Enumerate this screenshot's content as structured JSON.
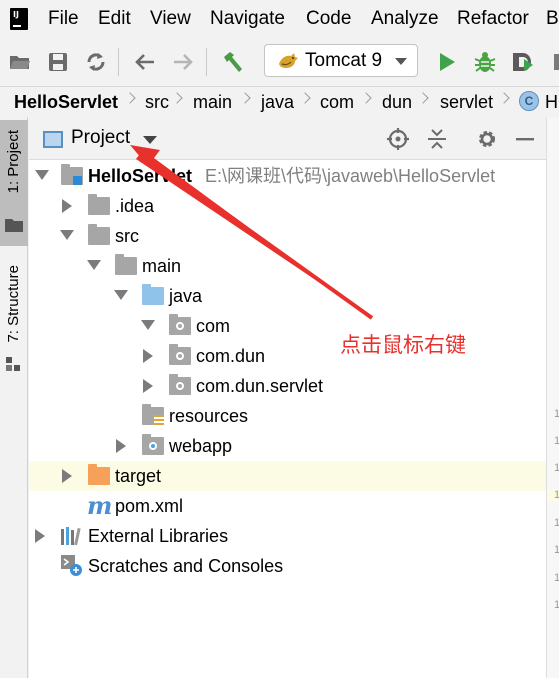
{
  "menubar": {
    "items": [
      "File",
      "Edit",
      "View",
      "Navigate",
      "Code",
      "Analyze",
      "Refactor",
      "B"
    ]
  },
  "toolbar": {
    "run_config": "Tomcat 9",
    "icons": [
      "open-folder-icon",
      "save-icon",
      "sync-icon",
      "back-arrow-icon",
      "forward-arrow-icon",
      "build-hammer-icon",
      "run-icon",
      "debug-icon",
      "coverage-icon",
      "stop-icon"
    ]
  },
  "breadcrumb": [
    "HelloServlet",
    "src",
    "main",
    "java",
    "com",
    "dun",
    "servlet",
    "H"
  ],
  "breadcrumb_class_letter": "C",
  "left_strip": {
    "tabs": [
      "1: Project",
      "7: Structure"
    ]
  },
  "project_panel": {
    "title": "Project",
    "tree": [
      {
        "label": "HelloServlet",
        "path": "E:\\网课班\\代码\\javaweb\\HelloServlet"
      },
      {
        "label": ".idea"
      },
      {
        "label": "src"
      },
      {
        "label": "main"
      },
      {
        "label": "java"
      },
      {
        "label": "com"
      },
      {
        "label": "com.dun"
      },
      {
        "label": "com.dun.servlet"
      },
      {
        "label": "resources"
      },
      {
        "label": "webapp"
      },
      {
        "label": "target"
      },
      {
        "label": "pom.xml"
      },
      {
        "label": "External Libraries"
      },
      {
        "label": "Scratches and Consoles"
      }
    ]
  },
  "gutter": {
    "numbers": [
      "1",
      "1",
      "1",
      "1",
      "1",
      "1",
      "1",
      "1"
    ]
  },
  "annotation": {
    "text": "点击鼠标右键",
    "color": "#e8312c"
  },
  "colors": {
    "highlight_row": "#fcfbe3",
    "source_folder": "#8fc3ea",
    "excluded_folder": "#f7a05a",
    "run": "#3ea34a",
    "debug": "#49a541"
  }
}
